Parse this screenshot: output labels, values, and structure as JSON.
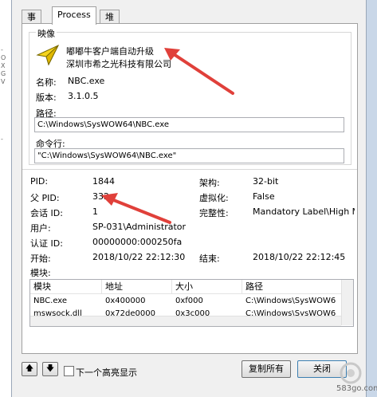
{
  "tabs": [
    "事件",
    "Process",
    "堆栈"
  ],
  "image_group": {
    "legend": "映像",
    "title_line1": "嘟嘟牛客户端自动升级",
    "title_line2": "深圳市希之光科技有限公司",
    "name_label": "名称:",
    "name_value": "NBC.exe",
    "version_label": "版本:",
    "version_value": "3.1.0.5",
    "path_label": "路径:",
    "path_value": "C:\\Windows\\SysWOW64\\NBC.exe",
    "cmd_label": "命令行:",
    "cmd_value": "\"C:\\Windows\\SysWOW64\\NBC.exe\""
  },
  "info": {
    "pid_label": "PID:",
    "pid_value": "1844",
    "ppid_label": "父 PID:",
    "ppid_value": "332",
    "session_label": "会话 ID:",
    "session_value": "1",
    "user_label": "用户:",
    "user_value": "SP-031\\Administrator",
    "auth_label": "认证 ID:",
    "auth_value": "00000000:000250fa",
    "start_label": "开始:",
    "start_value": "2018/10/22 22:12:30",
    "arch_label": "架构:",
    "arch_value": "32-bit",
    "virt_label": "虚拟化:",
    "virt_value": "False",
    "integrity_label": "完整性:",
    "integrity_value": "Mandatory Label\\High Mar",
    "end_label": "结束:",
    "end_value": "2018/10/22 22:12:45",
    "modules_label": "模块:"
  },
  "modules_table": {
    "headers": [
      "模块",
      "地址",
      "大小",
      "路径"
    ],
    "rows": [
      [
        "NBC.exe",
        "0x400000",
        "0xf000",
        "C:\\Windows\\SysWOW6"
      ],
      [
        "mswsock.dll",
        "0x72de0000",
        "0x3c000",
        "C:\\Windows\\SysWOW6"
      ]
    ]
  },
  "footer": {
    "up_arrow": "🡅",
    "down_arrow": "🡇",
    "next_highlight_label": "下一个高亮显示",
    "copy_all_label": "复制所有",
    "close_label": "关闭"
  },
  "watermark": "583go.com",
  "left_strip_glyphs": [
    "-",
    "O",
    "X",
    "G",
    "V",
    "-"
  ],
  "colors": {
    "arrow_red": "#e0403a",
    "panel_border": "#a0a0a0"
  }
}
